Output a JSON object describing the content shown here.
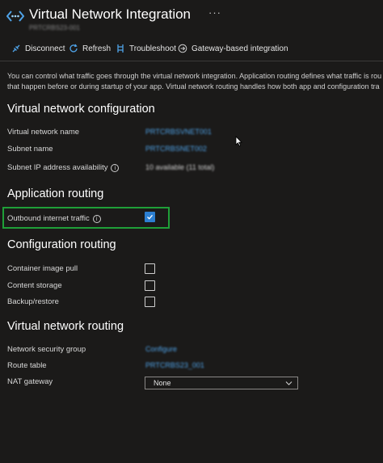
{
  "header": {
    "title": "Virtual Network Integration",
    "subtitle": "PRTCRBS23-001",
    "more": "···"
  },
  "toolbar": {
    "disconnect": "Disconnect",
    "refresh": "Refresh",
    "troubleshoot": "Troubleshoot",
    "gateway": "Gateway-based integration"
  },
  "description": {
    "line1": "You can control what traffic goes through the virtual network integration. Application routing defines what traffic is rou",
    "line2": "that happen before or during startup of your app. Virtual network routing handles how both app and configuration tra"
  },
  "vnet_config": {
    "title": "Virtual network configuration",
    "vnet_name_label": "Virtual network name",
    "vnet_name_value": "PRTCRBSVNET001",
    "subnet_label": "Subnet name",
    "subnet_value": "PRTCRBSNET002",
    "ip_label": "Subnet IP address availability",
    "ip_value": "10 available (11 total)"
  },
  "app_routing": {
    "title": "Application routing",
    "outbound_label": "Outbound internet traffic",
    "outbound_checked": true
  },
  "config_routing": {
    "title": "Configuration routing",
    "image_pull_label": "Container image pull",
    "content_storage_label": "Content storage",
    "backup_label": "Backup/restore"
  },
  "vnet_routing": {
    "title": "Virtual network routing",
    "nsg_label": "Network security group",
    "nsg_value": "Configure",
    "route_table_label": "Route table",
    "route_table_value": "PRTCRBS23_001",
    "nat_label": "NAT gateway",
    "nat_value": "None"
  },
  "colors": {
    "background": "#1b1a19",
    "accent": "#2c7fd1",
    "link": "#4fa3e8",
    "highlight": "#1f9f38"
  },
  "icons": {
    "blade": "vnet-icon",
    "disconnect": "disconnect-icon",
    "refresh": "refresh-icon",
    "troubleshoot": "troubleshoot-icon",
    "gateway": "gateway-icon"
  }
}
